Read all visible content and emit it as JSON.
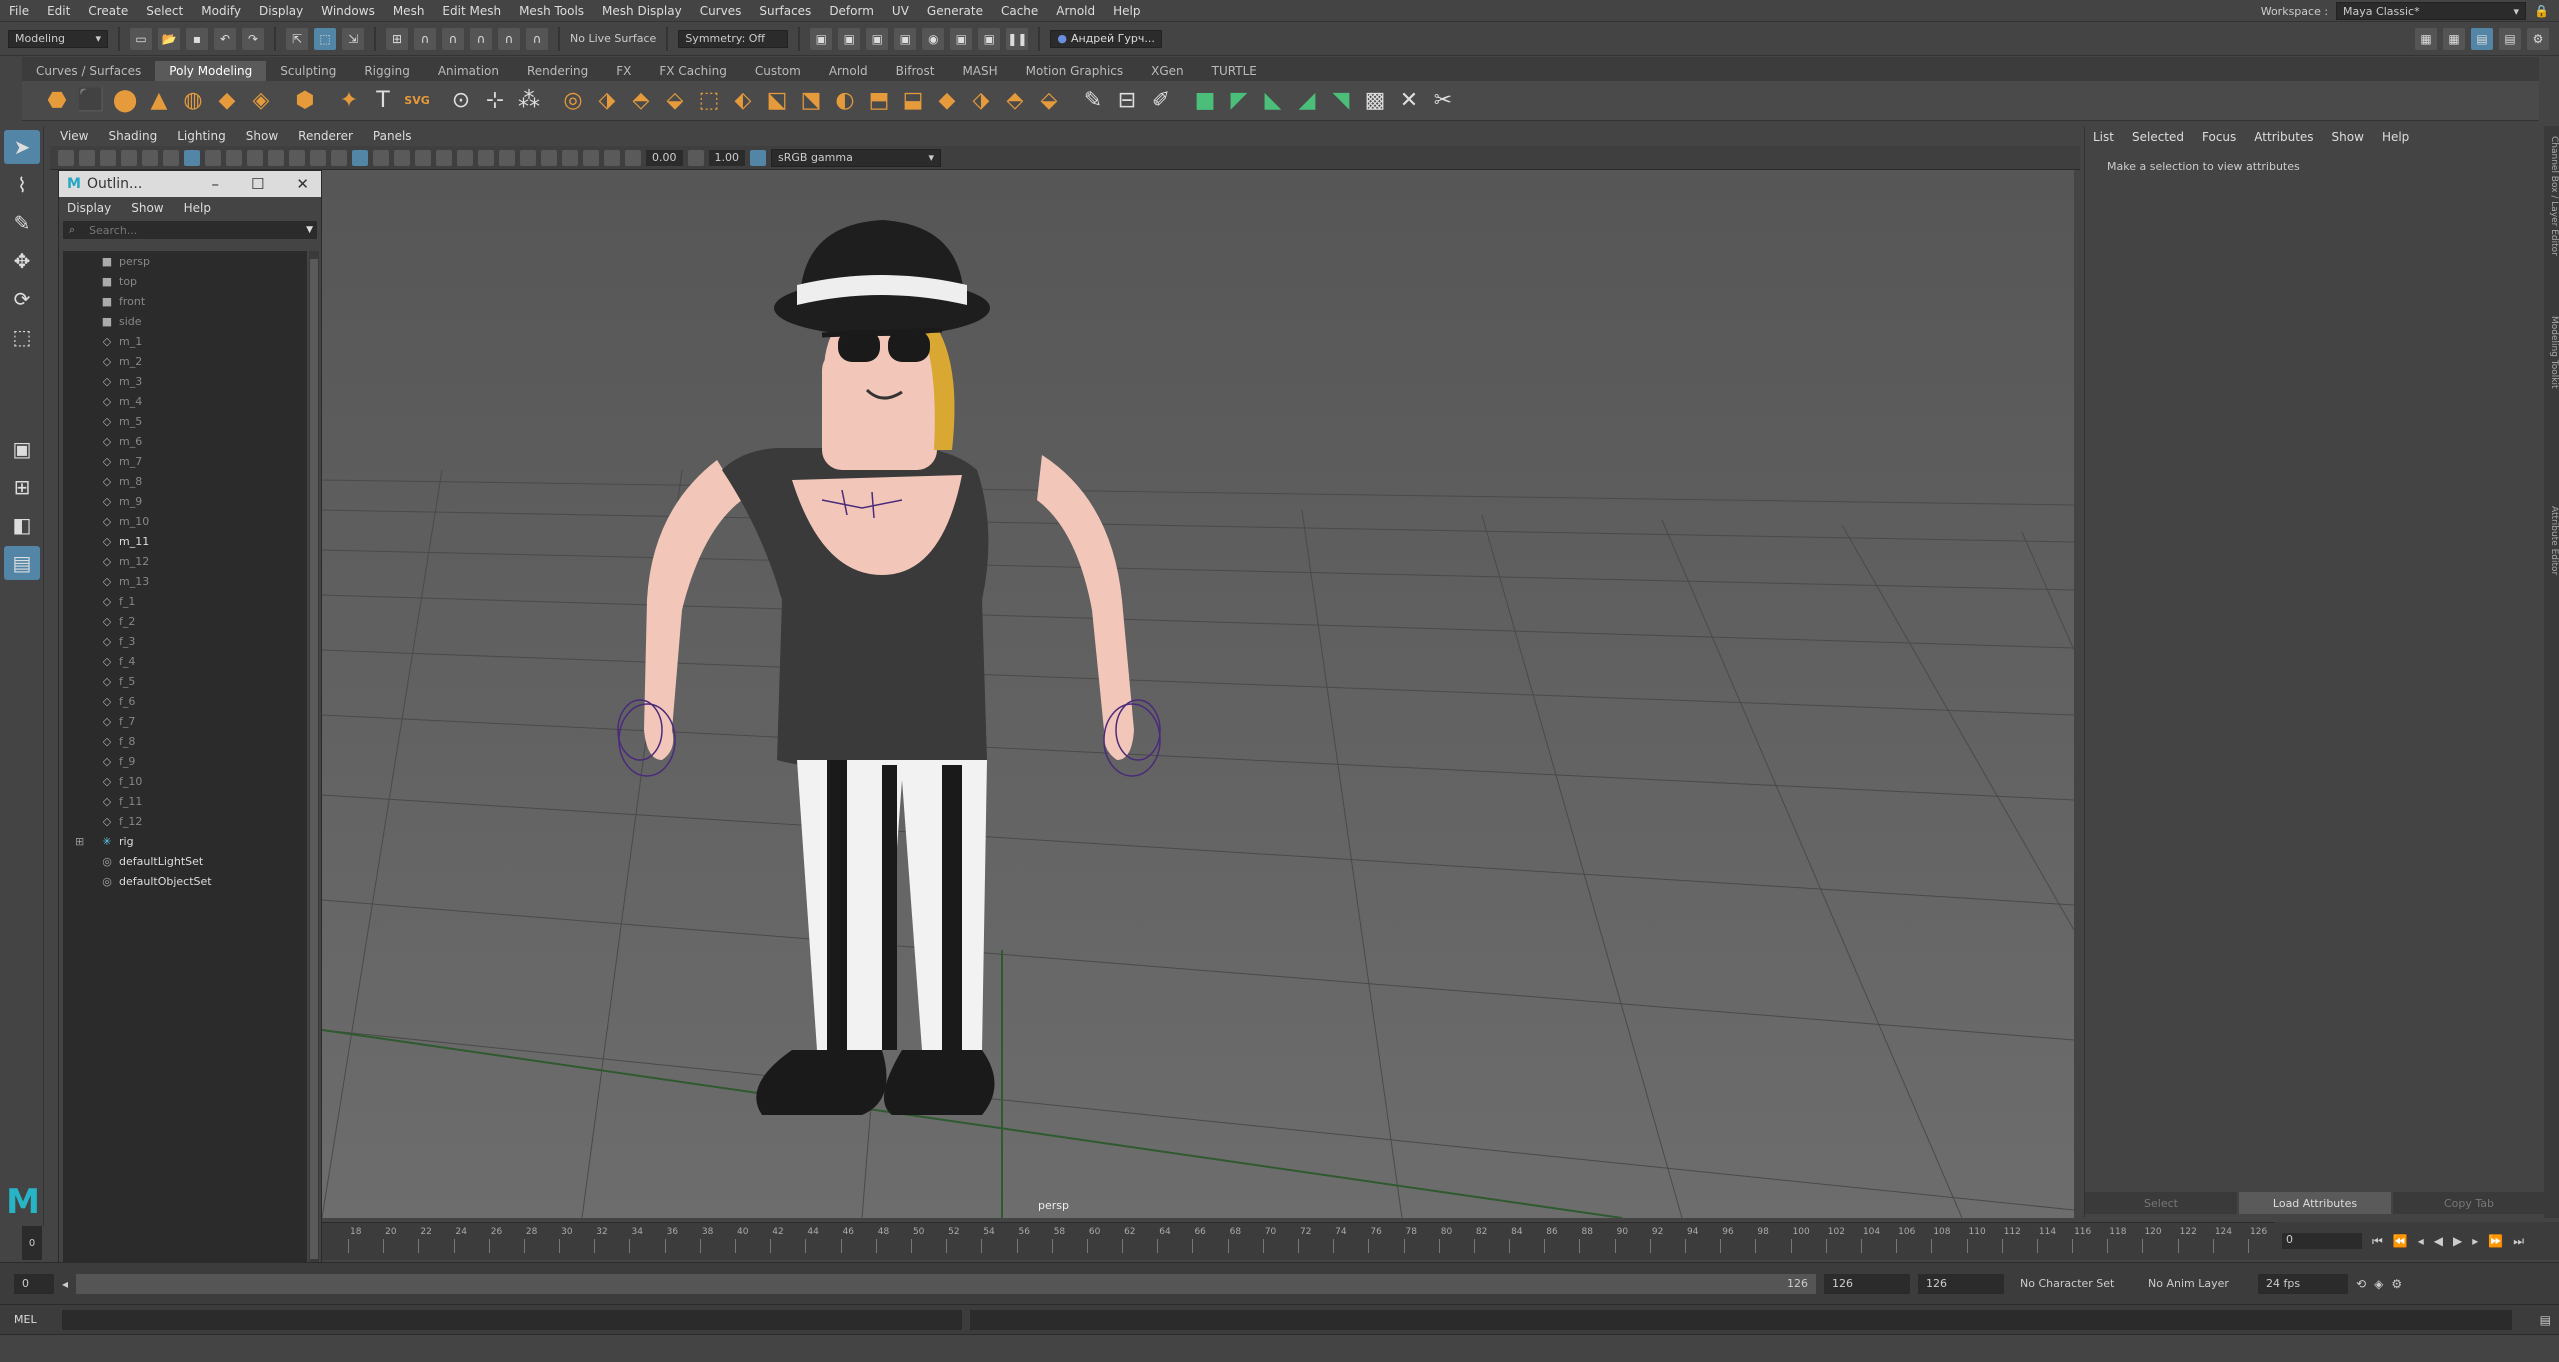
{
  "menubar": [
    "File",
    "Edit",
    "Create",
    "Select",
    "Modify",
    "Display",
    "Windows",
    "Mesh",
    "Edit Mesh",
    "Mesh Tools",
    "Mesh Display",
    "Curves",
    "Surfaces",
    "Deform",
    "UV",
    "Generate",
    "Cache",
    "Arnold",
    "Help"
  ],
  "workspace": {
    "label": "Workspace :",
    "value": "Maya Classic*"
  },
  "status": {
    "mode": "Modeling",
    "live_surface": "No Live Surface",
    "symmetry": "Symmetry: Off",
    "user": "Андрей Гурч..."
  },
  "shelf_tabs": [
    "Curves / Surfaces",
    "Poly Modeling",
    "Sculpting",
    "Rigging",
    "Animation",
    "Rendering",
    "FX",
    "FX Caching",
    "Custom",
    "Arnold",
    "Bifrost",
    "MASH",
    "Motion Graphics",
    "XGen",
    "TURTLE"
  ],
  "shelf_active": "Poly Modeling",
  "panel_menu": [
    "View",
    "Shading",
    "Lighting",
    "Show",
    "Renderer",
    "Panels"
  ],
  "panel_bar": {
    "exposure": "0.00",
    "gamma": "1.00",
    "colorspace": "sRGB gamma"
  },
  "viewport": {
    "camera": "persp"
  },
  "outliner": {
    "title": "Outlin...",
    "menu": [
      "Display",
      "Show",
      "Help"
    ],
    "search_placeholder": "Search...",
    "items": [
      {
        "label": "persp",
        "icon": "camera",
        "dim": true
      },
      {
        "label": "top",
        "icon": "camera",
        "dim": true
      },
      {
        "label": "front",
        "icon": "camera",
        "dim": true
      },
      {
        "label": "side",
        "icon": "camera",
        "dim": true
      },
      {
        "label": "m_1",
        "icon": "mesh",
        "dim": true
      },
      {
        "label": "m_2",
        "icon": "mesh",
        "dim": true
      },
      {
        "label": "m_3",
        "icon": "mesh",
        "dim": true
      },
      {
        "label": "m_4",
        "icon": "mesh",
        "dim": true
      },
      {
        "label": "m_5",
        "icon": "mesh",
        "dim": true
      },
      {
        "label": "m_6",
        "icon": "mesh",
        "dim": true
      },
      {
        "label": "m_7",
        "icon": "mesh",
        "dim": true
      },
      {
        "label": "m_8",
        "icon": "mesh",
        "dim": true
      },
      {
        "label": "m_9",
        "icon": "mesh",
        "dim": true
      },
      {
        "label": "m_10",
        "icon": "mesh",
        "dim": true
      },
      {
        "label": "m_11",
        "icon": "mesh",
        "dim": false
      },
      {
        "label": "m_12",
        "icon": "mesh",
        "dim": true
      },
      {
        "label": "m_13",
        "icon": "mesh",
        "dim": true
      },
      {
        "label": "f_1",
        "icon": "mesh",
        "dim": true
      },
      {
        "label": "f_2",
        "icon": "mesh",
        "dim": true
      },
      {
        "label": "f_3",
        "icon": "mesh",
        "dim": true
      },
      {
        "label": "f_4",
        "icon": "mesh",
        "dim": true
      },
      {
        "label": "f_5",
        "icon": "mesh",
        "dim": true
      },
      {
        "label": "f_6",
        "icon": "mesh",
        "dim": true
      },
      {
        "label": "f_7",
        "icon": "mesh",
        "dim": true
      },
      {
        "label": "f_8",
        "icon": "mesh",
        "dim": true
      },
      {
        "label": "f_9",
        "icon": "mesh",
        "dim": true
      },
      {
        "label": "f_10",
        "icon": "mesh",
        "dim": true
      },
      {
        "label": "f_11",
        "icon": "mesh",
        "dim": true
      },
      {
        "label": "f_12",
        "icon": "mesh",
        "dim": true
      },
      {
        "label": "rig",
        "icon": "joint",
        "dim": false
      },
      {
        "label": "defaultLightSet",
        "icon": "set",
        "dim": false
      },
      {
        "label": "defaultObjectSet",
        "icon": "set",
        "dim": false
      }
    ]
  },
  "attribute_editor": {
    "menu": [
      "List",
      "Selected",
      "Focus",
      "Attributes",
      "Show",
      "Help"
    ],
    "hint": "Make a selection to view attributes",
    "buttons": [
      "Select",
      "Load Attributes",
      "Copy Tab"
    ]
  },
  "side_tabs": [
    "Channel Box / Layer Editor",
    "Modeling Toolkit",
    "Attribute Editor"
  ],
  "timeline": {
    "ticks": [
      "18",
      "20",
      "22",
      "24",
      "26",
      "28",
      "30",
      "32",
      "34",
      "36",
      "38",
      "40",
      "42",
      "44",
      "46",
      "48",
      "50",
      "52",
      "54",
      "56",
      "58",
      "60",
      "62",
      "64",
      "66",
      "68",
      "70",
      "72",
      "74",
      "76",
      "78",
      "80",
      "82",
      "84",
      "86",
      "88",
      "90",
      "92",
      "94",
      "96",
      "98",
      "100",
      "102",
      "104",
      "106",
      "108",
      "110",
      "112",
      "114",
      "116",
      "118",
      "120",
      "122",
      "124",
      "126"
    ],
    "current_frame": "0"
  },
  "playback": {
    "current": "0"
  },
  "range": {
    "start": "0",
    "range_end_slider": "126",
    "end_a": "126",
    "end_b": "126",
    "character_set": "No Character Set",
    "anim_layer": "No Anim Layer",
    "fps": "24 fps"
  },
  "cmdline": {
    "label": "MEL"
  }
}
